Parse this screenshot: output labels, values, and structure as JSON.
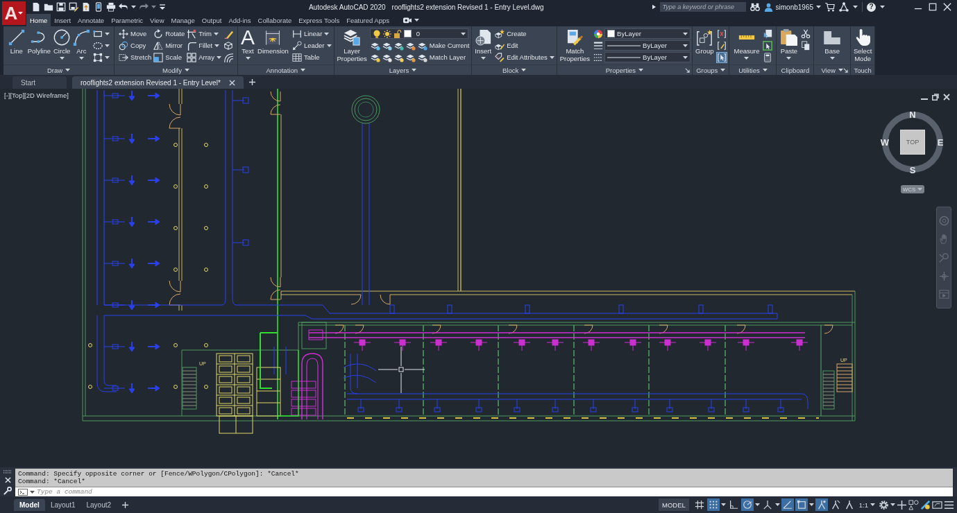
{
  "title_bar": {
    "app_glyph": "A",
    "redo_disabled": true,
    "app_title": "Autodesk AutoCAD 2020",
    "file_title": "rooflights2 extension Revised 1 - Entry Level.dwg",
    "search": {
      "placeholder": "Type a keyword or phrase"
    },
    "user": "simonb1965",
    "help_glyph": "?"
  },
  "ribbon_tabs": [
    {
      "label": "Home",
      "selected": true
    },
    {
      "label": "Insert",
      "selected": false
    },
    {
      "label": "Annotate",
      "selected": false
    },
    {
      "label": "Parametric",
      "selected": false
    },
    {
      "label": "View",
      "selected": false
    },
    {
      "label": "Manage",
      "selected": false
    },
    {
      "label": "Output",
      "selected": false
    },
    {
      "label": "Add-ins",
      "selected": false
    },
    {
      "label": "Collaborate",
      "selected": false
    },
    {
      "label": "Express Tools",
      "selected": false
    },
    {
      "label": "Featured Apps",
      "selected": false
    }
  ],
  "ribbon_panels": [
    {
      "title": "Draw",
      "menu": true,
      "launcher": false,
      "groups": [
        {
          "kind": "large",
          "tools": [
            {
              "label": "Line",
              "menu": false
            },
            {
              "label": "Polyline",
              "menu": false
            },
            {
              "label": "Circle",
              "menu": true
            },
            {
              "label": "Arc",
              "menu": true
            }
          ]
        },
        {
          "kind": "grid",
          "rows": [
            [
              {
                "kind": "tool",
                "menu": true
              }
            ],
            [
              {
                "kind": "tool",
                "menu": true
              }
            ],
            [
              {
                "kind": "tool",
                "menu": true
              }
            ]
          ]
        }
      ]
    },
    {
      "title": "Modify",
      "menu": true,
      "launcher": false,
      "groups": [
        {
          "kind": "grid",
          "rows": [
            [
              {
                "kind": "tool",
                "label": "Move",
                "menu": false
              },
              {
                "kind": "tool",
                "label": "Rotate",
                "menu": false
              },
              {
                "kind": "tool",
                "label": "Trim",
                "menu": true
              },
              {
                "kind": "tool",
                "menu": false
              }
            ],
            [
              {
                "kind": "tool",
                "label": "Copy",
                "menu": false
              },
              {
                "kind": "tool",
                "label": "Mirror",
                "menu": false
              },
              {
                "kind": "tool",
                "label": "Fillet",
                "menu": true
              },
              {
                "kind": "tool",
                "menu": false
              }
            ],
            [
              {
                "kind": "tool",
                "label": "Stretch",
                "menu": false
              },
              {
                "kind": "tool",
                "label": "Scale",
                "menu": false
              },
              {
                "kind": "tool",
                "label": "Array",
                "menu": true
              },
              {
                "kind": "tool",
                "menu": false
              }
            ]
          ]
        }
      ]
    },
    {
      "title": "Annotation",
      "menu": true,
      "launcher": false,
      "groups": [
        {
          "kind": "large",
          "tools": [
            {
              "label": "Text",
              "glyph": "A",
              "menu": true
            },
            {
              "label": "Dimension",
              "menu": false
            }
          ]
        },
        {
          "kind": "grid",
          "rows": [
            [
              {
                "kind": "tool",
                "label": "Linear",
                "menu": true
              }
            ],
            [
              {
                "kind": "tool",
                "label": "Leader",
                "menu": true
              }
            ],
            [
              {
                "kind": "tool",
                "label": "Table",
                "menu": false
              }
            ]
          ]
        }
      ]
    },
    {
      "title": "Layers",
      "menu": true,
      "launcher": false,
      "groups": [
        {
          "kind": "large",
          "tools": [
            {
              "label": "Layer Properties",
              "menu": false
            }
          ]
        },
        {
          "kind": "grid",
          "rows": [
            [
              {
                "kind": "dropdown",
                "value": "0"
              }
            ],
            [
              {
                "kind": "tool",
                "menu": false
              },
              {
                "kind": "tool",
                "menu": false
              },
              {
                "kind": "tool",
                "menu": false
              },
              {
                "kind": "tool",
                "menu": false
              },
              {
                "kind": "tool",
                "label": "Make Current",
                "menu": false
              }
            ],
            [
              {
                "kind": "tool",
                "menu": false
              },
              {
                "kind": "tool",
                "menu": false
              },
              {
                "kind": "tool",
                "menu": false
              },
              {
                "kind": "tool",
                "menu": false
              },
              {
                "kind": "tool",
                "label": "Match Layer",
                "menu": false
              }
            ]
          ]
        }
      ]
    },
    {
      "title": "Block",
      "menu": true,
      "launcher": false,
      "groups": [
        {
          "kind": "large",
          "tools": [
            {
              "label": "Insert",
              "menu": true
            }
          ]
        },
        {
          "kind": "grid",
          "rows": [
            [
              {
                "kind": "tool",
                "label": "Create",
                "menu": false
              }
            ],
            [
              {
                "kind": "tool",
                "label": "Edit",
                "menu": false
              }
            ],
            [
              {
                "kind": "tool",
                "label": "Edit Attributes",
                "menu": true
              }
            ]
          ]
        }
      ]
    },
    {
      "title": "Properties",
      "menu": true,
      "launcher": true,
      "groups": [
        {
          "kind": "large",
          "tools": [
            {
              "label": "Match Properties",
              "menu": false
            }
          ]
        },
        {
          "kind": "grid",
          "rows": [
            [
              {
                "kind": "tool",
                "menu": false
              },
              {
                "kind": "dropdown",
                "value": "ByLayer"
              }
            ],
            [
              {
                "kind": "tool",
                "menu": false
              },
              {
                "kind": "dropdown",
                "value": "ByLayer"
              }
            ],
            [
              {
                "kind": "tool",
                "menu": false
              },
              {
                "kind": "dropdown",
                "value": "ByLayer"
              }
            ]
          ]
        }
      ]
    },
    {
      "title": "Groups",
      "menu": true,
      "launcher": false,
      "groups": [
        {
          "kind": "large",
          "tools": [
            {
              "label": "Group",
              "menu": false
            }
          ]
        },
        {
          "kind": "grid",
          "rows": [
            [
              {
                "kind": "tool",
                "menu": false,
                "on": false
              }
            ],
            [
              {
                "kind": "tool",
                "menu": false,
                "on": false
              }
            ],
            [
              {
                "kind": "tool",
                "menu": false,
                "on": true
              }
            ]
          ]
        }
      ]
    },
    {
      "title": "Utilities",
      "menu": true,
      "launcher": false,
      "groups": [
        {
          "kind": "large",
          "tools": [
            {
              "label": "Measure",
              "menu": true
            }
          ]
        },
        {
          "kind": "grid",
          "rows": [
            [
              {
                "kind": "tool",
                "menu": false
              }
            ],
            [
              {
                "kind": "tool",
                "menu": false
              }
            ],
            [
              {
                "kind": "tool",
                "menu": false
              }
            ]
          ]
        }
      ]
    },
    {
      "title": "Clipboard",
      "menu": false,
      "launcher": false,
      "groups": [
        {
          "kind": "large",
          "tools": [
            {
              "label": "Paste",
              "menu": true
            }
          ]
        },
        {
          "kind": "grid",
          "rows": [
            [
              {
                "kind": "tool",
                "menu": false
              }
            ],
            [
              {
                "kind": "tool",
                "menu": false
              }
            ]
          ]
        }
      ]
    },
    {
      "title": "View",
      "menu": true,
      "launcher": true,
      "groups": [
        {
          "kind": "large",
          "tools": [
            {
              "label": "Base",
              "menu": true
            }
          ]
        }
      ]
    },
    {
      "title": "Touch",
      "menu": false,
      "launcher": false,
      "groups": [
        {
          "kind": "large",
          "tools": [
            {
              "label": "Select Mode",
              "menu": false
            }
          ]
        }
      ]
    }
  ],
  "file_tabs": [
    {
      "label": "Start",
      "selected": false
    },
    {
      "label": "rooflights2 extension Revised 1 - Entry Level*",
      "selected": true
    }
  ],
  "viewport": {
    "controls": [
      "[-]",
      "[Top]",
      "[2D Wireframe]"
    ],
    "drawing_labels": [
      "UP",
      "UP"
    ],
    "viewcube": {
      "directions": [
        "N",
        "E",
        "S",
        "W"
      ],
      "face": "TOP",
      "coordinate_system": "WCS"
    }
  },
  "command_line": {
    "history": [
      "Command: Specify opposite corner or [Fence/WPolygon/CPolygon]: *Cancel*",
      "Command: *Cancel*"
    ],
    "input": {
      "placeholder": "Type a command"
    }
  },
  "layout_tabs": [
    {
      "label": "Model",
      "selected": true
    },
    {
      "label": "Layout1",
      "selected": false
    },
    {
      "label": "Layout2",
      "selected": false
    }
  ],
  "status_bar": {
    "space": "MODEL",
    "toggles": [
      {
        "on": false,
        "menu": false
      },
      {
        "on": true,
        "menu": true
      },
      {
        "on": false,
        "menu": false
      },
      {
        "on": true,
        "menu": true
      },
      {
        "on": false,
        "menu": true
      },
      {
        "on": true,
        "menu": false
      },
      {
        "on": true,
        "menu": true
      },
      {
        "on": true,
        "menu": false
      },
      {
        "on": false,
        "menu": false
      },
      {
        "on": false,
        "menu": false
      }
    ],
    "annotation_scale": "1:1"
  }
}
